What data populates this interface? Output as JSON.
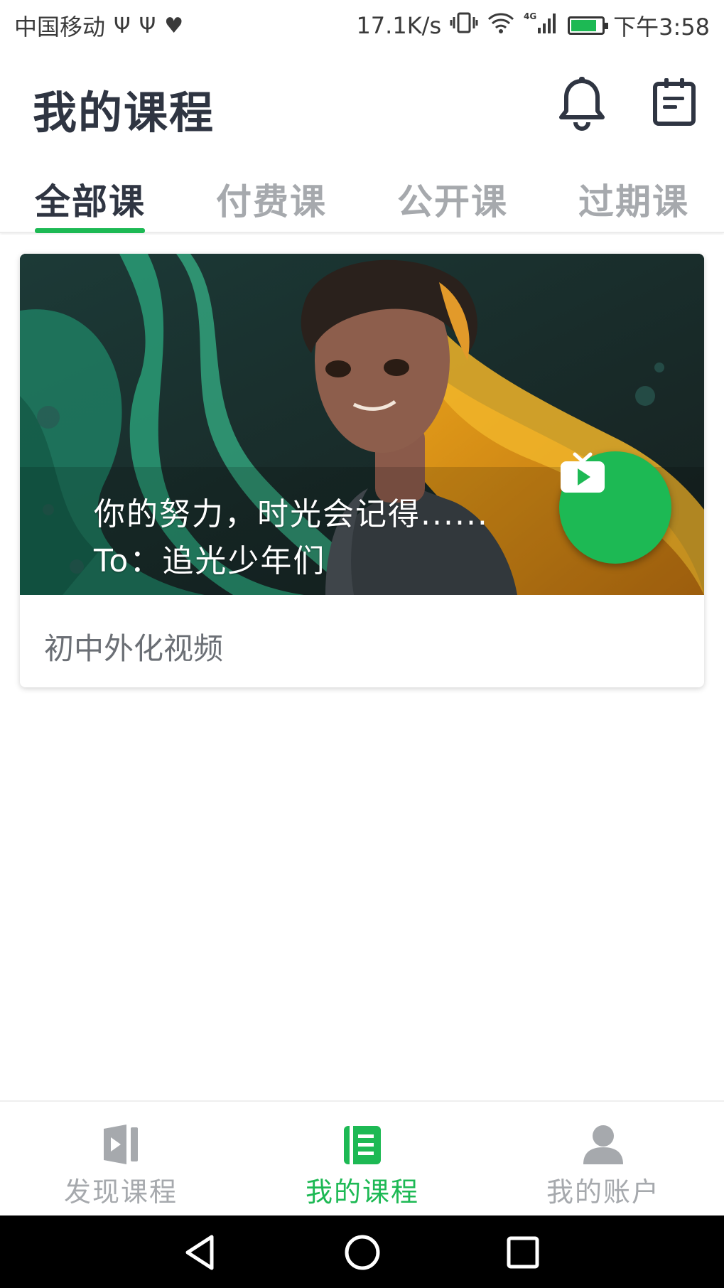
{
  "status_bar": {
    "carrier": "中国移动",
    "usb_glyph_1": "Ψ",
    "usb_glyph_2": "Ψ",
    "heart_glyph": "♥",
    "net_speed": "17.1K/s",
    "network_type": "4G",
    "time": "下午3:58",
    "battery_level": 0.75,
    "icons": [
      "usb-icon",
      "usb-icon",
      "heart-rate-icon",
      "vibrate-icon",
      "wifi-icon",
      "signal-icon",
      "battery-icon"
    ]
  },
  "header": {
    "title": "我的课程",
    "icons": [
      "bell-icon",
      "notes-icon"
    ]
  },
  "tabs": [
    {
      "label": "全部课",
      "active": true
    },
    {
      "label": "付费课",
      "active": false
    },
    {
      "label": "公开课",
      "active": false
    },
    {
      "label": "过期课",
      "active": false
    }
  ],
  "courses": [
    {
      "cover_text_line1": "你的努力，时光会记得......",
      "cover_text_line2": "To：追光少年们",
      "title": "初中外化视频",
      "badge_icon": "tv-play-icon"
    }
  ],
  "bottom_nav": [
    {
      "label": "发现课程",
      "icon": "video-book-icon",
      "active": false
    },
    {
      "label": "我的课程",
      "icon": "notebook-icon",
      "active": true
    },
    {
      "label": "我的账户",
      "icon": "user-icon",
      "active": false
    }
  ],
  "system_nav": {
    "icons": [
      "back-icon",
      "home-icon",
      "recents-icon"
    ]
  },
  "colors": {
    "accent": "#1db954",
    "title_text": "#2f3542",
    "inactive_text": "#a6a9ad",
    "system_bar": "#000000"
  }
}
